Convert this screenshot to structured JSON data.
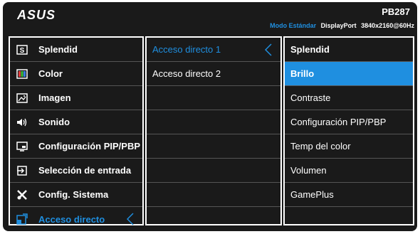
{
  "header": {
    "logo": "ASUS",
    "model": "PB287",
    "mode": "Modo Estándar",
    "input": "DisplayPort",
    "resolution": "3840x2160@60Hz"
  },
  "main_menu": [
    {
      "label": "Splendid",
      "icon": "splendid-icon"
    },
    {
      "label": "Color",
      "icon": "color-icon"
    },
    {
      "label": "Imagen",
      "icon": "image-icon"
    },
    {
      "label": "Sonido",
      "icon": "speaker-icon"
    },
    {
      "label": "Configuración PIP/PBP",
      "icon": "pip-icon"
    },
    {
      "label": "Selección de entrada",
      "icon": "input-select-icon"
    },
    {
      "label": "Config. Sistema",
      "icon": "wrench-icon"
    },
    {
      "label": "Acceso directo",
      "icon": "shortcut-icon",
      "active": true
    }
  ],
  "submenu": [
    {
      "label": "Acceso directo 1",
      "active": true
    },
    {
      "label": "Acceso directo 2"
    }
  ],
  "options": [
    {
      "label": "Splendid"
    },
    {
      "label": "Brillo",
      "selected": true
    },
    {
      "label": "Contraste"
    },
    {
      "label": "Configuración PIP/PBP"
    },
    {
      "label": "Temp del color"
    },
    {
      "label": "Volumen"
    },
    {
      "label": "GamePlus"
    }
  ],
  "colors": {
    "accent": "#1f8fe0",
    "background": "#1a1a1a"
  }
}
